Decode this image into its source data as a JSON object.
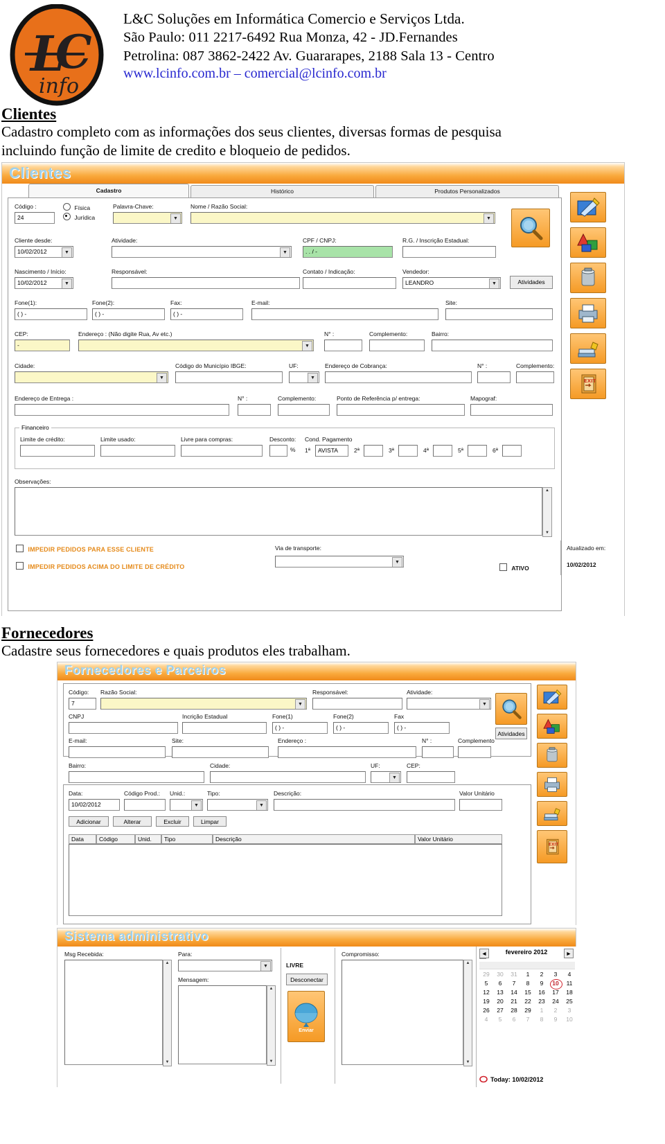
{
  "letterhead": {
    "line1": "L&C Soluções em Informática Comercio e Serviços Ltda.",
    "line2": "São Paulo: 011 2217-6492 Rua Monza, 42  -  JD.Fernandes",
    "line3": "Petrolina:   087 3862-2422 Av. Guararapes, 2188 Sala 13 - Centro",
    "line4": "www.lcinfo.com.br – comercial@lcinfo.com.br",
    "logo_text_top": "L",
    "logo_text_mid": "C",
    "logo_text_bottom": "info"
  },
  "sections": {
    "clientes": {
      "title": "Clientes",
      "description_line1": "Cadastro completo com as informações dos seus clientes, diversas formas de pesquisa",
      "description_line2": "incluindo função de limite de credito e bloqueio de pedidos."
    },
    "fornecedores": {
      "title": "Fornecedores",
      "description_line1": "Cadastre seus fornecedores e quais produtos eles trabalham."
    }
  },
  "clientes_app": {
    "banner_title": "Clientes",
    "tabs": [
      {
        "label": "Cadastro",
        "active": true
      },
      {
        "label": "Histórico",
        "active": false
      },
      {
        "label": "Produtos Personalizados",
        "active": false
      }
    ],
    "labels": {
      "codigo": "Código :",
      "fisica": "Física",
      "juridica": "Jurídica",
      "palavra_chave": "Palavra-Chave:",
      "nome_razao": "Nome / Razão Social:",
      "cliente_desde": "Cliente desde:",
      "atividade": "Atividade:",
      "cpf_cnpj": "CPF / CNPJ:",
      "rg_ie": "R.G. / Inscrição Estadual:",
      "nascimento": "Nascimento / Início:",
      "responsavel": "Responsável:",
      "contato": "Contato / Indicação:",
      "vendedor": "Vendedor:",
      "fone1": "Fone(1):",
      "fone2": "Fone(2):",
      "fax": "Fax:",
      "email": "E-mail:",
      "site": "Site:",
      "cep": "CEP:",
      "endereco": "Endereço : (Não digite Rua, Av etc.)",
      "numero": "N° :",
      "complemento": "Complemento:",
      "bairro": "Bairro:",
      "cidade": "Cidade:",
      "ibge": "Código do Município IBGE:",
      "uf": "UF:",
      "end_cobranca": "Endereço de Cobrança:",
      "end_entrega": "Endereço de Entrega :",
      "ponto_ref": "Ponto de Referência p/ entrega:",
      "mapograf": "Mapograf:",
      "financeiro": "Financeiro",
      "limite_credito": "Limite de crédito:",
      "limite_usado": "Limite usado:",
      "livre_compras": "Livre para compras:",
      "desconto": "Desconto:",
      "cond_pagamento": "Cond. Pagamento",
      "percent": "%",
      "observacoes": "Observações:",
      "via_transporte": "Via de transporte:",
      "atualizado_em": "Atualizado em:",
      "atividades_btn": "Atividades"
    },
    "values": {
      "codigo": "24",
      "cliente_desde": "10/02/2012",
      "nascimento": "10/02/2012",
      "cpf_cnpj": " .   .   /    -",
      "vendedor": "LEANDRO",
      "fone1": "(  )      -",
      "fone2": "(  )      -",
      "fax": "(  )      -",
      "cep": "      -",
      "atualizado_em": "10/02/2012",
      "parcela_1": "AVISTA"
    },
    "parcelas": [
      "1ª",
      "2ª",
      "3ª",
      "4ª",
      "5ª",
      "6ª"
    ],
    "checkboxes": [
      {
        "label": "IMPEDIR PEDIDOS PARA ESSE CLIENTE",
        "checked": false
      },
      {
        "label": "IMPEDIR PEDIDOS ACIMA DO LIMITE DE CRÉDITO",
        "checked": false
      },
      {
        "label": "ATIVO",
        "checked": false
      }
    ],
    "icon_rail": [
      "pen-edit-icon",
      "shapes-new-icon",
      "trash-delete-icon",
      "printer-icon",
      "broom-clear-icon",
      "exit-door-icon"
    ],
    "search_icon": "magnifier-search-icon",
    "radio_selected": "juridica"
  },
  "fornecedores_app": {
    "banner_title": "Fornecedores e Parceiros",
    "labels": {
      "codigo": "Código:",
      "razao_social": "Razão Social:",
      "responsavel": "Responsável:",
      "atividade": "Atividade:",
      "cnpj": "CNPJ",
      "inscricao_estadual": "Incrição Estadual",
      "fone1": "Fone(1)",
      "fone2": "Fone(2)",
      "fax": "Fax",
      "email": "E-mail:",
      "site": "Site:",
      "endereco": "Endereço :",
      "numero": "N° :",
      "complemento": "Complemento",
      "bairro": "Bairro:",
      "cidade": "Cidade:",
      "uf": "UF:",
      "cep": "CEP:",
      "data": "Data:",
      "codigo_prod": "Código Prod.:",
      "unid": "Unid.:",
      "tipo": "Tipo:",
      "descricao": "Descrição:",
      "valor_unitario": "Valor Unitário",
      "atividades_btn": "Atividades"
    },
    "values": {
      "codigo": "7",
      "fone1": "(  )    -",
      "fone2": "(  )    -",
      "fax": "(  )    -",
      "data": "10/02/2012"
    },
    "action_buttons": [
      "Adicionar",
      "Alterar",
      "Excluir",
      "Limpar"
    ],
    "grid_headers": [
      "Data",
      "Código",
      "Unid.",
      "Tipo",
      "Descrição",
      "Valor Unitário"
    ],
    "icon_rail": [
      "pen-edit-icon",
      "shapes-new-icon",
      "trash-delete-icon",
      "printer-icon",
      "broom-clear-icon",
      "exit-door-icon"
    ],
    "search_icon": "magnifier-search-icon"
  },
  "sistema_app": {
    "banner_title": "Sistema administrativo",
    "labels": {
      "msg_recebida": "Msg Recebida:",
      "para": "Para:",
      "mensagem": "Mensagem:",
      "compromisso": "Compromisso:",
      "livre": "LIVRE",
      "desconectar": "Desconectar",
      "enviar": "Enviar"
    },
    "calendar": {
      "month_label": "fevereiro 2012",
      "prev": "◄",
      "next": "►",
      "today_label": "Today: 10/02/2012",
      "today_day": "10",
      "weeks": [
        [
          "29",
          "30",
          "31",
          "1",
          "2",
          "3",
          "4"
        ],
        [
          "5",
          "6",
          "7",
          "8",
          "9",
          "10",
          "11"
        ],
        [
          "12",
          "13",
          "14",
          "15",
          "16",
          "17",
          "18"
        ],
        [
          "19",
          "20",
          "21",
          "22",
          "23",
          "24",
          "25"
        ],
        [
          "26",
          "27",
          "28",
          "29",
          "1",
          "2",
          "3"
        ],
        [
          "4",
          "5",
          "6",
          "7",
          "8",
          "9",
          "10"
        ]
      ],
      "dim_cells": [
        [
          true,
          true,
          true,
          false,
          false,
          false,
          false
        ],
        [
          false,
          false,
          false,
          false,
          false,
          false,
          false
        ],
        [
          false,
          false,
          false,
          false,
          false,
          false,
          false
        ],
        [
          false,
          false,
          false,
          false,
          false,
          false,
          false
        ],
        [
          false,
          false,
          false,
          false,
          true,
          true,
          true
        ],
        [
          true,
          true,
          true,
          true,
          true,
          true,
          true
        ]
      ]
    }
  },
  "colors": {
    "banner_orange": "#f59a25",
    "banner_title_blue": "#9fd0ea",
    "field_yellow": "#fbf7c7",
    "field_green": "#a8e3a8",
    "warning_orange": "#e58a1a",
    "link_blue": "#2626cf"
  }
}
